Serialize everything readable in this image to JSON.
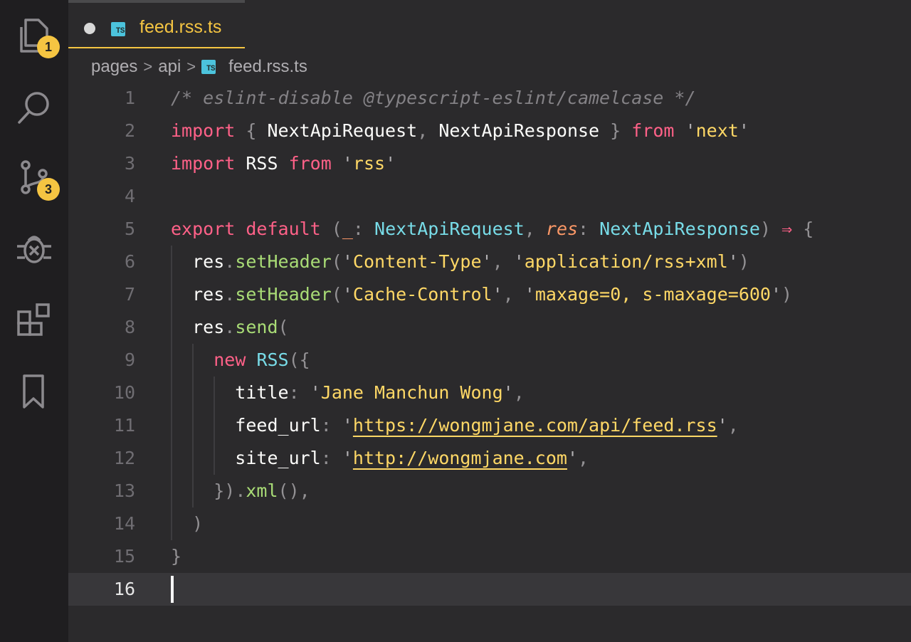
{
  "activity_bar": {
    "explorer_badge": "1",
    "source_control_badge": "3",
    "icons": [
      "files-icon",
      "search-icon",
      "source-control-icon",
      "debug-icon",
      "extensions-icon",
      "bookmark-icon"
    ]
  },
  "tab": {
    "label": "feed.rss.ts",
    "language_badge": "TS",
    "unsaved": true
  },
  "breadcrumb": {
    "items": [
      "pages",
      "api",
      "feed.rss.ts"
    ]
  },
  "editor": {
    "active_line": 16,
    "lines": [
      {
        "n": "1",
        "tokens": [
          [
            "cm",
            "/* eslint-disable @typescript-eslint/camelcase */"
          ]
        ]
      },
      {
        "n": "2",
        "tokens": [
          [
            "kw",
            "import"
          ],
          [
            "id",
            " "
          ],
          [
            "pu",
            "{"
          ],
          [
            "id",
            " NextApiRequest"
          ],
          [
            "pu",
            ","
          ],
          [
            "id",
            " NextApiResponse "
          ],
          [
            "pu",
            "}"
          ],
          [
            "id",
            " "
          ],
          [
            "kw",
            "from"
          ],
          [
            "id",
            " "
          ],
          [
            "q",
            "'"
          ],
          [
            "str",
            "next"
          ],
          [
            "q",
            "'"
          ]
        ]
      },
      {
        "n": "3",
        "tokens": [
          [
            "kw",
            "import"
          ],
          [
            "id",
            " RSS "
          ],
          [
            "kw",
            "from"
          ],
          [
            "id",
            " "
          ],
          [
            "q",
            "'"
          ],
          [
            "str",
            "rss"
          ],
          [
            "q",
            "'"
          ]
        ]
      },
      {
        "n": "4",
        "tokens": []
      },
      {
        "n": "5",
        "tokens": [
          [
            "kw",
            "export"
          ],
          [
            "id",
            " "
          ],
          [
            "kw",
            "default"
          ],
          [
            "id",
            " "
          ],
          [
            "pu",
            "("
          ],
          [
            "par",
            "_"
          ],
          [
            "pu",
            ":"
          ],
          [
            "id",
            " "
          ],
          [
            "ty",
            "NextApiRequest"
          ],
          [
            "pu",
            ","
          ],
          [
            "id",
            " "
          ],
          [
            "par",
            "res"
          ],
          [
            "pu",
            ":"
          ],
          [
            "id",
            " "
          ],
          [
            "ty",
            "NextApiResponse"
          ],
          [
            "pu",
            ")"
          ],
          [
            "id",
            " "
          ],
          [
            "pink",
            "⇒"
          ],
          [
            "id",
            " "
          ],
          [
            "pu",
            "{"
          ]
        ]
      },
      {
        "n": "6",
        "tokens": [
          [
            "id",
            "  res"
          ],
          [
            "pu",
            "."
          ],
          [
            "fn",
            "setHeader"
          ],
          [
            "pu",
            "("
          ],
          [
            "q",
            "'"
          ],
          [
            "str",
            "Content-Type"
          ],
          [
            "q",
            "'"
          ],
          [
            "pu",
            ","
          ],
          [
            "id",
            " "
          ],
          [
            "q",
            "'"
          ],
          [
            "str",
            "application/rss+xml"
          ],
          [
            "q",
            "'"
          ],
          [
            "pu",
            ")"
          ]
        ]
      },
      {
        "n": "7",
        "tokens": [
          [
            "id",
            "  res"
          ],
          [
            "pu",
            "."
          ],
          [
            "fn",
            "setHeader"
          ],
          [
            "pu",
            "("
          ],
          [
            "q",
            "'"
          ],
          [
            "str",
            "Cache-Control"
          ],
          [
            "q",
            "'"
          ],
          [
            "pu",
            ","
          ],
          [
            "id",
            " "
          ],
          [
            "q",
            "'"
          ],
          [
            "str",
            "maxage=0, s-maxage=600"
          ],
          [
            "q",
            "'"
          ],
          [
            "pu",
            ")"
          ]
        ]
      },
      {
        "n": "8",
        "tokens": [
          [
            "id",
            "  res"
          ],
          [
            "pu",
            "."
          ],
          [
            "fn",
            "send"
          ],
          [
            "pu",
            "("
          ]
        ]
      },
      {
        "n": "9",
        "tokens": [
          [
            "id",
            "    "
          ],
          [
            "kw",
            "new"
          ],
          [
            "id",
            " "
          ],
          [
            "ty",
            "RSS"
          ],
          [
            "pu",
            "({"
          ]
        ]
      },
      {
        "n": "10",
        "tokens": [
          [
            "id",
            "      title"
          ],
          [
            "pu",
            ":"
          ],
          [
            "id",
            " "
          ],
          [
            "q",
            "'"
          ],
          [
            "str",
            "Jane Manchun Wong"
          ],
          [
            "q",
            "'"
          ],
          [
            "pu",
            ","
          ]
        ]
      },
      {
        "n": "11",
        "tokens": [
          [
            "id",
            "      feed_url"
          ],
          [
            "pu",
            ":"
          ],
          [
            "id",
            " "
          ],
          [
            "q",
            "'"
          ],
          [
            "url",
            "https://wongmjane.com/api/feed.rss"
          ],
          [
            "q",
            "'"
          ],
          [
            "pu",
            ","
          ]
        ]
      },
      {
        "n": "12",
        "tokens": [
          [
            "id",
            "      site_url"
          ],
          [
            "pu",
            ":"
          ],
          [
            "id",
            " "
          ],
          [
            "q",
            "'"
          ],
          [
            "url",
            "http://wongmjane.com"
          ],
          [
            "q",
            "'"
          ],
          [
            "pu",
            ","
          ]
        ]
      },
      {
        "n": "13",
        "tokens": [
          [
            "id",
            "    "
          ],
          [
            "pu",
            "})."
          ],
          [
            "fn",
            "xml"
          ],
          [
            "pu",
            "(),"
          ]
        ]
      },
      {
        "n": "14",
        "tokens": [
          [
            "id",
            "  "
          ],
          [
            "pu",
            ")"
          ]
        ]
      },
      {
        "n": "15",
        "tokens": [
          [
            "pu",
            "}"
          ]
        ]
      },
      {
        "n": "16",
        "tokens": []
      }
    ]
  }
}
